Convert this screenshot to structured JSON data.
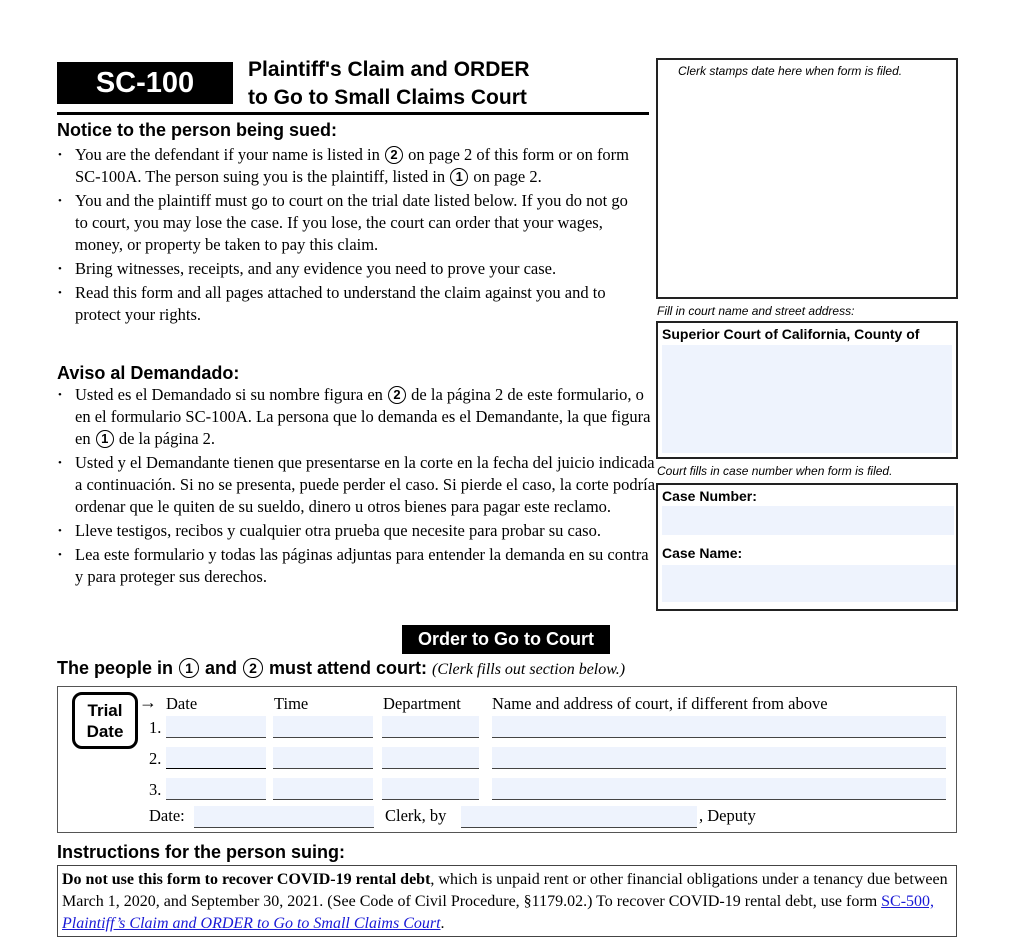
{
  "header": {
    "form_id": "SC-100",
    "title_line1": "Plaintiff's Claim and ORDER",
    "title_line2": "to Go to Small Claims Court"
  },
  "notice": {
    "heading": "Notice to the person being sued:",
    "bullets": [
      {
        "a": "You are the defendant if your name is listed in ",
        "c1": "2",
        "b": " on page 2 of this form or on form SC-100A. The person suing you is the plaintiff, listed in ",
        "c2": "1",
        "d": " on page 2."
      },
      {
        "text": "You and the plaintiff must go to court on the trial date listed below. If you do not go to court, you may lose the case. If you lose, the court can order that your wages, money, or property be taken to pay this claim."
      },
      {
        "text": "Bring witnesses, receipts, and any evidence you need to prove your case."
      },
      {
        "text": "Read this form and all pages attached to understand the claim against you and to protect your rights."
      }
    ]
  },
  "aviso": {
    "heading": "Aviso al Demandado:",
    "bullets": [
      {
        "a": "Usted es el Demandado si su nombre figura en ",
        "c1": "2",
        "b": " de la página 2 de este formulario, o en el formulario SC-100A. La persona que lo demanda es el Demandante, la que figura en ",
        "c2": "1",
        "d": " de la página 2."
      },
      {
        "text": "Usted y el Demandante tienen que presentarse en la corte en la fecha del juicio indicada a continuación. Si no se presenta, puede perder el caso. Si pierde el caso, la corte podría ordenar que le quiten de su sueldo, dinero u otros bienes para pagar este reclamo."
      },
      {
        "text": "Lleve testigos, recibos y cualquier otra prueba que necesite para probar su caso."
      },
      {
        "text": "Lea este formulario y todas las páginas adjuntas para entender la demanda en su contra y para proteger sus derechos."
      }
    ]
  },
  "right_column": {
    "stamp_label": "Clerk stamps date here when form is filed.",
    "court_label": "Fill in court name and street address:",
    "court_prefix": "Superior Court of California, County of",
    "court_value": "",
    "case_label": "Court fills in case number when form is filed.",
    "case_number_label": "Case Number:",
    "case_number_value": "",
    "case_name_label": "Case Name:",
    "case_name_value": ""
  },
  "order": {
    "banner": "Order to Go to Court",
    "attend_a": "The people in ",
    "c1": "1",
    "attend_b": " and ",
    "c2": "2",
    "attend_c": " must attend court: ",
    "attend_note": "(Clerk fills out section below.)"
  },
  "trial": {
    "badge_line1": "Trial",
    "badge_line2": "Date",
    "arrow": "→",
    "columns": [
      "Date",
      "Time",
      "Department",
      "Name and address of court, if different from above"
    ],
    "row_labels": [
      "1.",
      "2.",
      "3."
    ],
    "rows": [
      {
        "date": "",
        "time": "",
        "department": "",
        "court": ""
      },
      {
        "date": "",
        "time": "",
        "department": "",
        "court": ""
      },
      {
        "date": "",
        "time": "",
        "department": "",
        "court": ""
      }
    ],
    "date_label": "Date:",
    "date_value": "",
    "clerk_label": "Clerk, by",
    "clerk_value": "",
    "deputy_label": ", Deputy"
  },
  "instructions": {
    "heading": "Instructions for the person suing:",
    "bold": "Do not use this form to recover COVID-19 rental debt",
    "text": ", which is unpaid rent or other financial obligations under a tenancy due between March 1, 2020, and September 30, 2021. (See Code of Civil Procedure, §1179.02.) To recover COVID-19 rental debt, use form ",
    "link_a": "SC-500, ",
    "link_b": "Plaintiff’s Claim and ORDER to Go to Small Claims Court",
    "end": "."
  },
  "colors": {
    "field_fill": "#eef3fd",
    "link": "#1a1ad6"
  }
}
